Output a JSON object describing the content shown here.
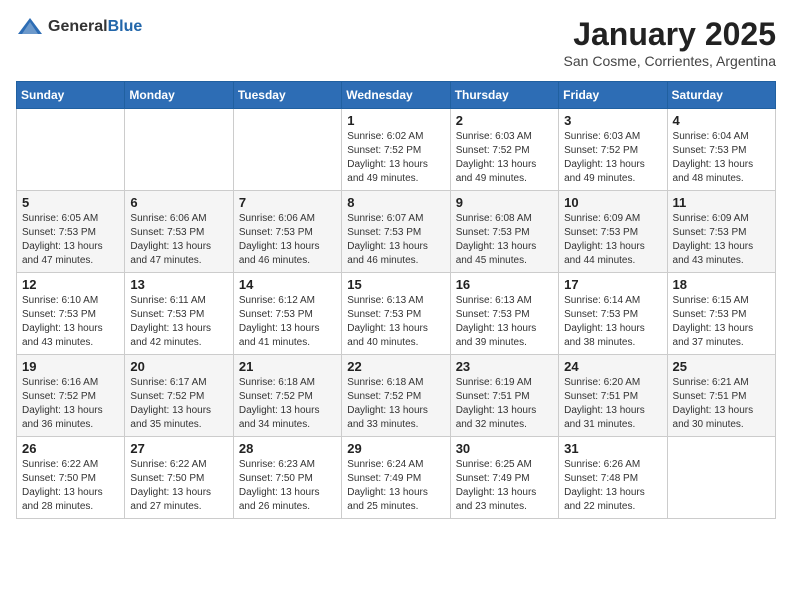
{
  "logo": {
    "general": "General",
    "blue": "Blue"
  },
  "header": {
    "month": "January 2025",
    "location": "San Cosme, Corrientes, Argentina"
  },
  "weekdays": [
    "Sunday",
    "Monday",
    "Tuesday",
    "Wednesday",
    "Thursday",
    "Friday",
    "Saturday"
  ],
  "weeks": [
    [
      {
        "day": "",
        "info": ""
      },
      {
        "day": "",
        "info": ""
      },
      {
        "day": "",
        "info": ""
      },
      {
        "day": "1",
        "info": "Sunrise: 6:02 AM\nSunset: 7:52 PM\nDaylight: 13 hours\nand 49 minutes."
      },
      {
        "day": "2",
        "info": "Sunrise: 6:03 AM\nSunset: 7:52 PM\nDaylight: 13 hours\nand 49 minutes."
      },
      {
        "day": "3",
        "info": "Sunrise: 6:03 AM\nSunset: 7:52 PM\nDaylight: 13 hours\nand 49 minutes."
      },
      {
        "day": "4",
        "info": "Sunrise: 6:04 AM\nSunset: 7:53 PM\nDaylight: 13 hours\nand 48 minutes."
      }
    ],
    [
      {
        "day": "5",
        "info": "Sunrise: 6:05 AM\nSunset: 7:53 PM\nDaylight: 13 hours\nand 47 minutes."
      },
      {
        "day": "6",
        "info": "Sunrise: 6:06 AM\nSunset: 7:53 PM\nDaylight: 13 hours\nand 47 minutes."
      },
      {
        "day": "7",
        "info": "Sunrise: 6:06 AM\nSunset: 7:53 PM\nDaylight: 13 hours\nand 46 minutes."
      },
      {
        "day": "8",
        "info": "Sunrise: 6:07 AM\nSunset: 7:53 PM\nDaylight: 13 hours\nand 46 minutes."
      },
      {
        "day": "9",
        "info": "Sunrise: 6:08 AM\nSunset: 7:53 PM\nDaylight: 13 hours\nand 45 minutes."
      },
      {
        "day": "10",
        "info": "Sunrise: 6:09 AM\nSunset: 7:53 PM\nDaylight: 13 hours\nand 44 minutes."
      },
      {
        "day": "11",
        "info": "Sunrise: 6:09 AM\nSunset: 7:53 PM\nDaylight: 13 hours\nand 43 minutes."
      }
    ],
    [
      {
        "day": "12",
        "info": "Sunrise: 6:10 AM\nSunset: 7:53 PM\nDaylight: 13 hours\nand 43 minutes."
      },
      {
        "day": "13",
        "info": "Sunrise: 6:11 AM\nSunset: 7:53 PM\nDaylight: 13 hours\nand 42 minutes."
      },
      {
        "day": "14",
        "info": "Sunrise: 6:12 AM\nSunset: 7:53 PM\nDaylight: 13 hours\nand 41 minutes."
      },
      {
        "day": "15",
        "info": "Sunrise: 6:13 AM\nSunset: 7:53 PM\nDaylight: 13 hours\nand 40 minutes."
      },
      {
        "day": "16",
        "info": "Sunrise: 6:13 AM\nSunset: 7:53 PM\nDaylight: 13 hours\nand 39 minutes."
      },
      {
        "day": "17",
        "info": "Sunrise: 6:14 AM\nSunset: 7:53 PM\nDaylight: 13 hours\nand 38 minutes."
      },
      {
        "day": "18",
        "info": "Sunrise: 6:15 AM\nSunset: 7:53 PM\nDaylight: 13 hours\nand 37 minutes."
      }
    ],
    [
      {
        "day": "19",
        "info": "Sunrise: 6:16 AM\nSunset: 7:52 PM\nDaylight: 13 hours\nand 36 minutes."
      },
      {
        "day": "20",
        "info": "Sunrise: 6:17 AM\nSunset: 7:52 PM\nDaylight: 13 hours\nand 35 minutes."
      },
      {
        "day": "21",
        "info": "Sunrise: 6:18 AM\nSunset: 7:52 PM\nDaylight: 13 hours\nand 34 minutes."
      },
      {
        "day": "22",
        "info": "Sunrise: 6:18 AM\nSunset: 7:52 PM\nDaylight: 13 hours\nand 33 minutes."
      },
      {
        "day": "23",
        "info": "Sunrise: 6:19 AM\nSunset: 7:51 PM\nDaylight: 13 hours\nand 32 minutes."
      },
      {
        "day": "24",
        "info": "Sunrise: 6:20 AM\nSunset: 7:51 PM\nDaylight: 13 hours\nand 31 minutes."
      },
      {
        "day": "25",
        "info": "Sunrise: 6:21 AM\nSunset: 7:51 PM\nDaylight: 13 hours\nand 30 minutes."
      }
    ],
    [
      {
        "day": "26",
        "info": "Sunrise: 6:22 AM\nSunset: 7:50 PM\nDaylight: 13 hours\nand 28 minutes."
      },
      {
        "day": "27",
        "info": "Sunrise: 6:22 AM\nSunset: 7:50 PM\nDaylight: 13 hours\nand 27 minutes."
      },
      {
        "day": "28",
        "info": "Sunrise: 6:23 AM\nSunset: 7:50 PM\nDaylight: 13 hours\nand 26 minutes."
      },
      {
        "day": "29",
        "info": "Sunrise: 6:24 AM\nSunset: 7:49 PM\nDaylight: 13 hours\nand 25 minutes."
      },
      {
        "day": "30",
        "info": "Sunrise: 6:25 AM\nSunset: 7:49 PM\nDaylight: 13 hours\nand 23 minutes."
      },
      {
        "day": "31",
        "info": "Sunrise: 6:26 AM\nSunset: 7:48 PM\nDaylight: 13 hours\nand 22 minutes."
      },
      {
        "day": "",
        "info": ""
      }
    ]
  ]
}
